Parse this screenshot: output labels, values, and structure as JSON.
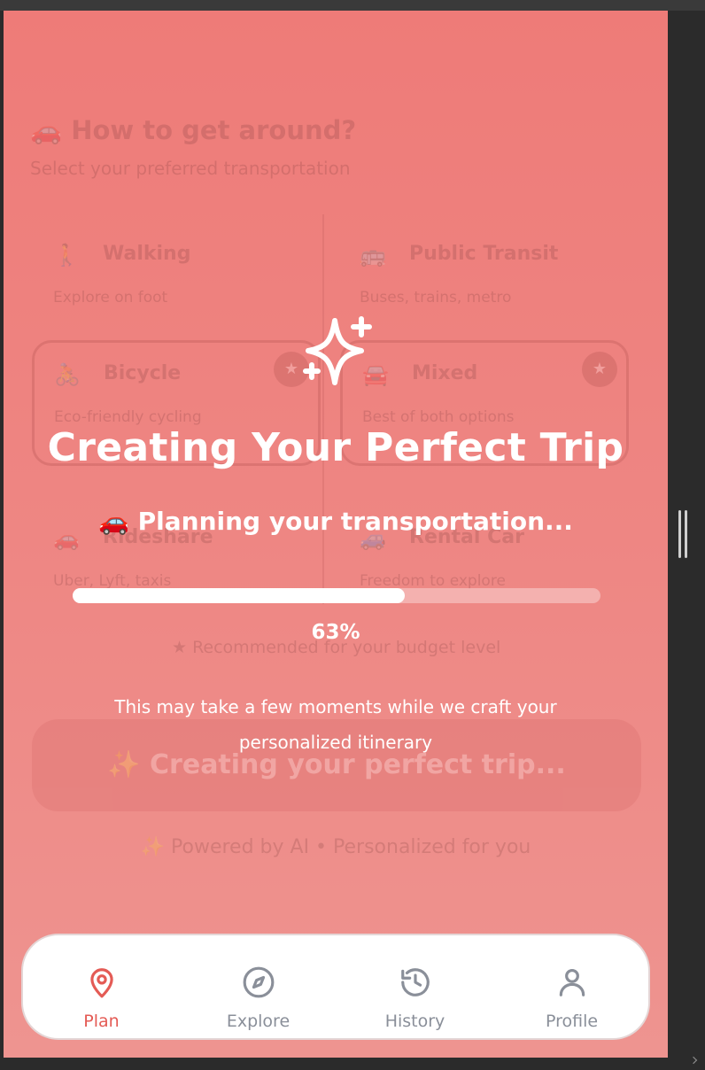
{
  "colors": {
    "overlay_top": "#ee7b78",
    "overlay_bottom": "#ee9490",
    "accent": "#e45b55",
    "nav_inactive": "#8a8f99"
  },
  "background": {
    "section_title": "🚗 How to get around?",
    "section_subtitle": "Select your preferred transportation",
    "options": [
      {
        "icon": "🚶",
        "name": "Walking",
        "desc": "Explore on foot"
      },
      {
        "icon": "🚌",
        "name": "Public Transit",
        "desc": "Buses, trains, metro"
      },
      {
        "icon": "🚴",
        "name": "Bicycle",
        "desc": "Eco-friendly cycling"
      },
      {
        "icon": "🚘",
        "name": "Mixed",
        "desc": "Best of both options"
      },
      {
        "icon": "🚗",
        "name": "Rideshare",
        "desc": "Uber, Lyft, taxis"
      },
      {
        "icon": "🚙",
        "name": "Rental Car",
        "desc": "Freedom to explore"
      }
    ],
    "recommendation": "★ Recommended for your budget level",
    "create_button": "✨ Creating your perfect trip...",
    "powered_by": "✨ Powered by AI • Personalized for you"
  },
  "loading": {
    "icon": "sparkles-icon",
    "title": "Creating Your Perfect Trip",
    "status": "🚗 Planning your transportation...",
    "progress_percent": 63,
    "progress_label": "63%",
    "note": "This may take a few moments while we craft your personalized itinerary"
  },
  "nav": {
    "items": [
      {
        "label": "Plan",
        "icon": "map-pin-icon",
        "active": true
      },
      {
        "label": "Explore",
        "icon": "compass-icon",
        "active": false
      },
      {
        "label": "History",
        "icon": "history-icon",
        "active": false
      },
      {
        "label": "Profile",
        "icon": "user-icon",
        "active": false
      }
    ]
  }
}
